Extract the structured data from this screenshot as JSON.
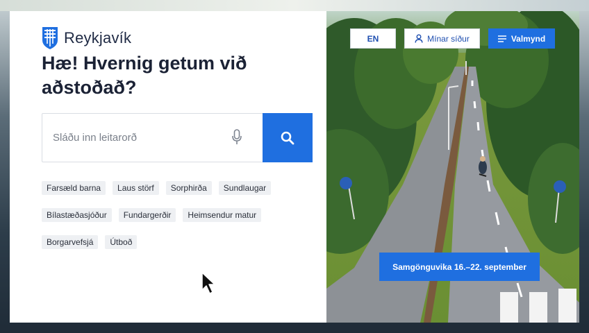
{
  "brand": {
    "name": "Reykjavík"
  },
  "hero": {
    "title": "Hæ! Hvernig getum við aðstoðað?"
  },
  "search": {
    "placeholder": "Sláðu inn leitarorð",
    "value": ""
  },
  "quick_links": [
    [
      "Farsæld barna",
      "Laus störf",
      "Sorphirða",
      "Sundlaugar"
    ],
    [
      "Bílastæðasjóður",
      "Fundargerðir",
      "Heimsendur matur"
    ],
    [
      "Borgarvefsjá",
      "Útboð"
    ]
  ],
  "topbar": {
    "lang": "EN",
    "my_pages": "Mínar síður",
    "menu": "Valmynd"
  },
  "banner": {
    "label": "Samgönguvika 16.–22. september"
  },
  "colors": {
    "primary": "#1f6fe0",
    "text": "#1b2235",
    "chip_bg": "#eef0f3"
  },
  "icons": [
    "reykjavik-logo-icon",
    "microphone-icon",
    "search-icon",
    "user-icon",
    "menu-icon",
    "mouse-cursor-icon"
  ]
}
